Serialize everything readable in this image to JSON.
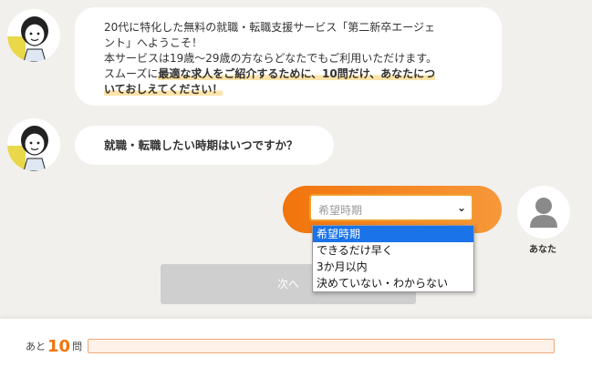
{
  "chat": {
    "greeting": {
      "line1": "20代に特化した無料の就職・転職支援サービス「第二新卒エージェ",
      "line2": "ント」へようこそ！",
      "line3": "本サービスは19歳～29歳の方ならどなたでもご利用いただけます。",
      "line4_pre": "スムーズに",
      "line4_hl": "最適な求人をご紹介するために、10問だけ、あなたについておしえてください！",
      "line4_hl_a": "最適な求人をご紹介するために、10問だけ、あなたにつ",
      "line4_hl_b": "いておしえてください！"
    },
    "question": "就職・転職したい時期はいつですか？"
  },
  "answer": {
    "select_value": "希望時期",
    "options": [
      "希望時期",
      "できるだけ早く",
      "3か月以内",
      "決めていない・わからない"
    ],
    "selected_index": 0
  },
  "user": {
    "label": "あなた"
  },
  "next_button": {
    "label": "次へ"
  },
  "footer": {
    "remain_prefix": "あと",
    "remain_count": "10",
    "remain_suffix": "問",
    "progress_fraction": 0
  },
  "colors": {
    "accent": "#f2740c",
    "highlight": "#fde3a7",
    "selected_option": "#1a73e8",
    "disabled_button": "#cfcfcf"
  }
}
